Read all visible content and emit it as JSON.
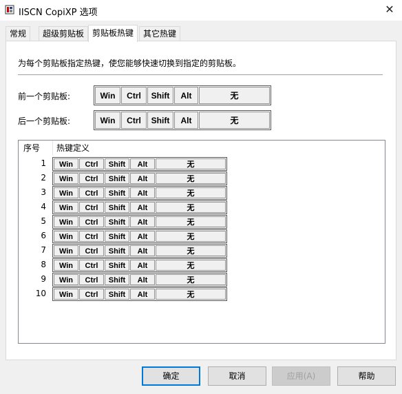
{
  "window": {
    "title": "IISCN CopiXP 选项",
    "close_glyph": "✕"
  },
  "tabs": [
    {
      "label": "常规"
    },
    {
      "label": "超级剪贴板"
    },
    {
      "label": "剪贴板热键",
      "active": true
    },
    {
      "label": "其它热键"
    }
  ],
  "page": {
    "description": "为每个剪贴板指定热键，使您能够快速切换到指定的剪贴板。",
    "prev_label": "前一个剪贴板:",
    "next_label": "后一个剪贴板:"
  },
  "keys": {
    "win": "Win",
    "ctrl": "Ctrl",
    "shift": "Shift",
    "alt": "Alt",
    "none": "无"
  },
  "list": {
    "col_index": "序号",
    "col_hotkey": "热键定义",
    "rows": [
      "1",
      "2",
      "3",
      "4",
      "5",
      "6",
      "7",
      "8",
      "9",
      "10"
    ]
  },
  "buttons": {
    "ok": "确定",
    "cancel": "取消",
    "apply": "应用(A)",
    "help": "帮助"
  }
}
